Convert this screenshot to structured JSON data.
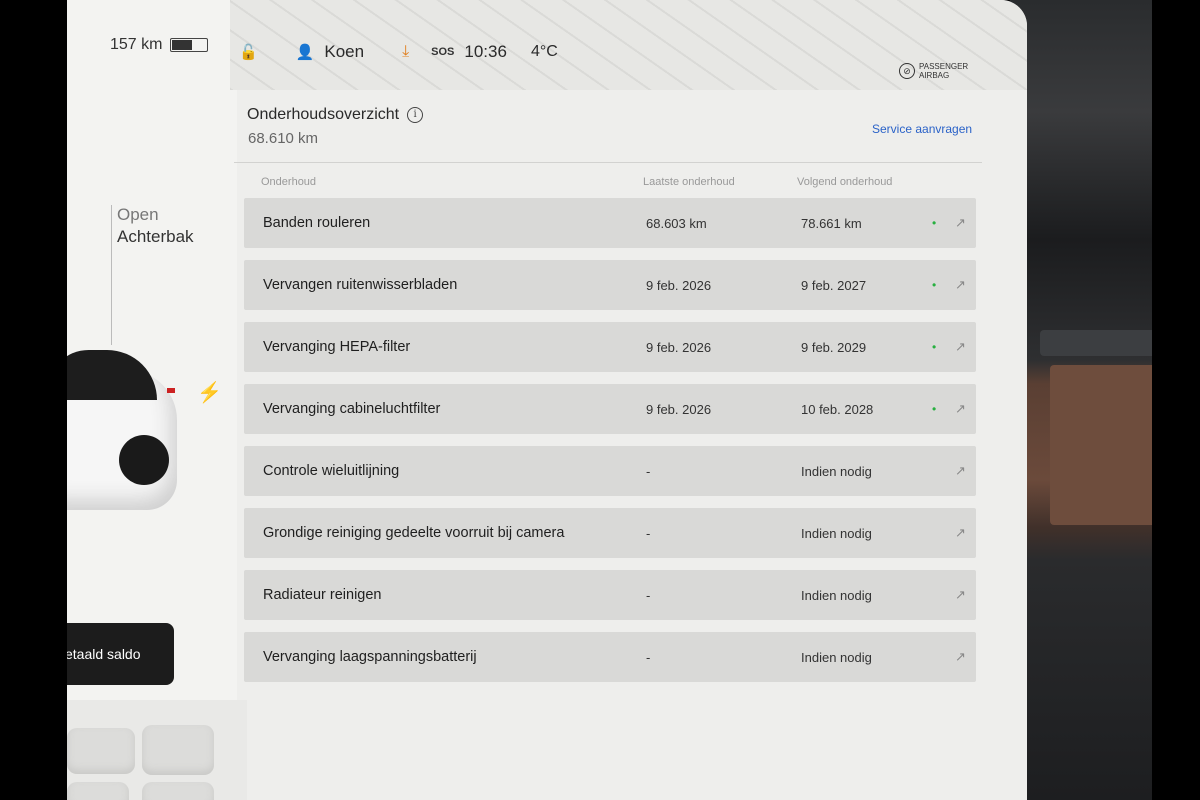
{
  "status": {
    "range": "157 km",
    "user": "Koen",
    "sos": "SOS",
    "time": "10:36",
    "temperature": "4°C",
    "airbag_line1": "PASSENGER",
    "airbag_line2": "AIRBAG"
  },
  "left_panel": {
    "trunk_open": "Open",
    "trunk_name": "Achterbak",
    "pay_button": "etaald saldo"
  },
  "maintenance": {
    "title": "Onderhoudsoverzicht",
    "odometer": "68.610  km",
    "service_link": "Service aanvragen",
    "headers": {
      "task": "Onderhoud",
      "last": "Laatste onderhoud",
      "next": "Volgend onderhoud"
    },
    "rows": [
      {
        "task": "Banden rouleren",
        "last": "68.603 km",
        "next": "78.661 km",
        "dot": "•",
        "arrow": "↗"
      },
      {
        "task": "Vervangen ruitenwisserbladen",
        "last": "9 feb. 2026",
        "next": "9 feb. 2027",
        "dot": "•",
        "arrow": "↗"
      },
      {
        "task": "Vervanging HEPA-filter",
        "last": "9 feb. 2026",
        "next": "9 feb. 2029",
        "dot": "•",
        "arrow": "↗"
      },
      {
        "task": "Vervanging cabineluchtfilter",
        "last": "9 feb. 2026",
        "next": "10 feb. 2028",
        "dot": "•",
        "arrow": "↗"
      },
      {
        "task": "Controle wieluitlijning",
        "last": "-",
        "next": "Indien nodig",
        "dot": "",
        "arrow": "↗"
      },
      {
        "task": "Grondige reiniging gedeelte voorruit bij camera",
        "last": "-",
        "next": "Indien nodig",
        "dot": "",
        "arrow": "↗"
      },
      {
        "task": "Radiateur reinigen",
        "last": "-",
        "next": "Indien nodig",
        "dot": "",
        "arrow": "↗"
      },
      {
        "task": "Vervanging laagspanningsbatterij",
        "last": "-",
        "next": "Indien nodig",
        "dot": "",
        "arrow": "↗"
      }
    ]
  },
  "colors": {
    "accent": "#2a62c8",
    "status_ok": "#28b040",
    "download": "#e08020"
  },
  "icons": [
    "lock-open-icon",
    "user-icon",
    "download-icon",
    "info-icon",
    "arrow-up-right-icon",
    "bolt-icon",
    "airbag-off-icon"
  ]
}
